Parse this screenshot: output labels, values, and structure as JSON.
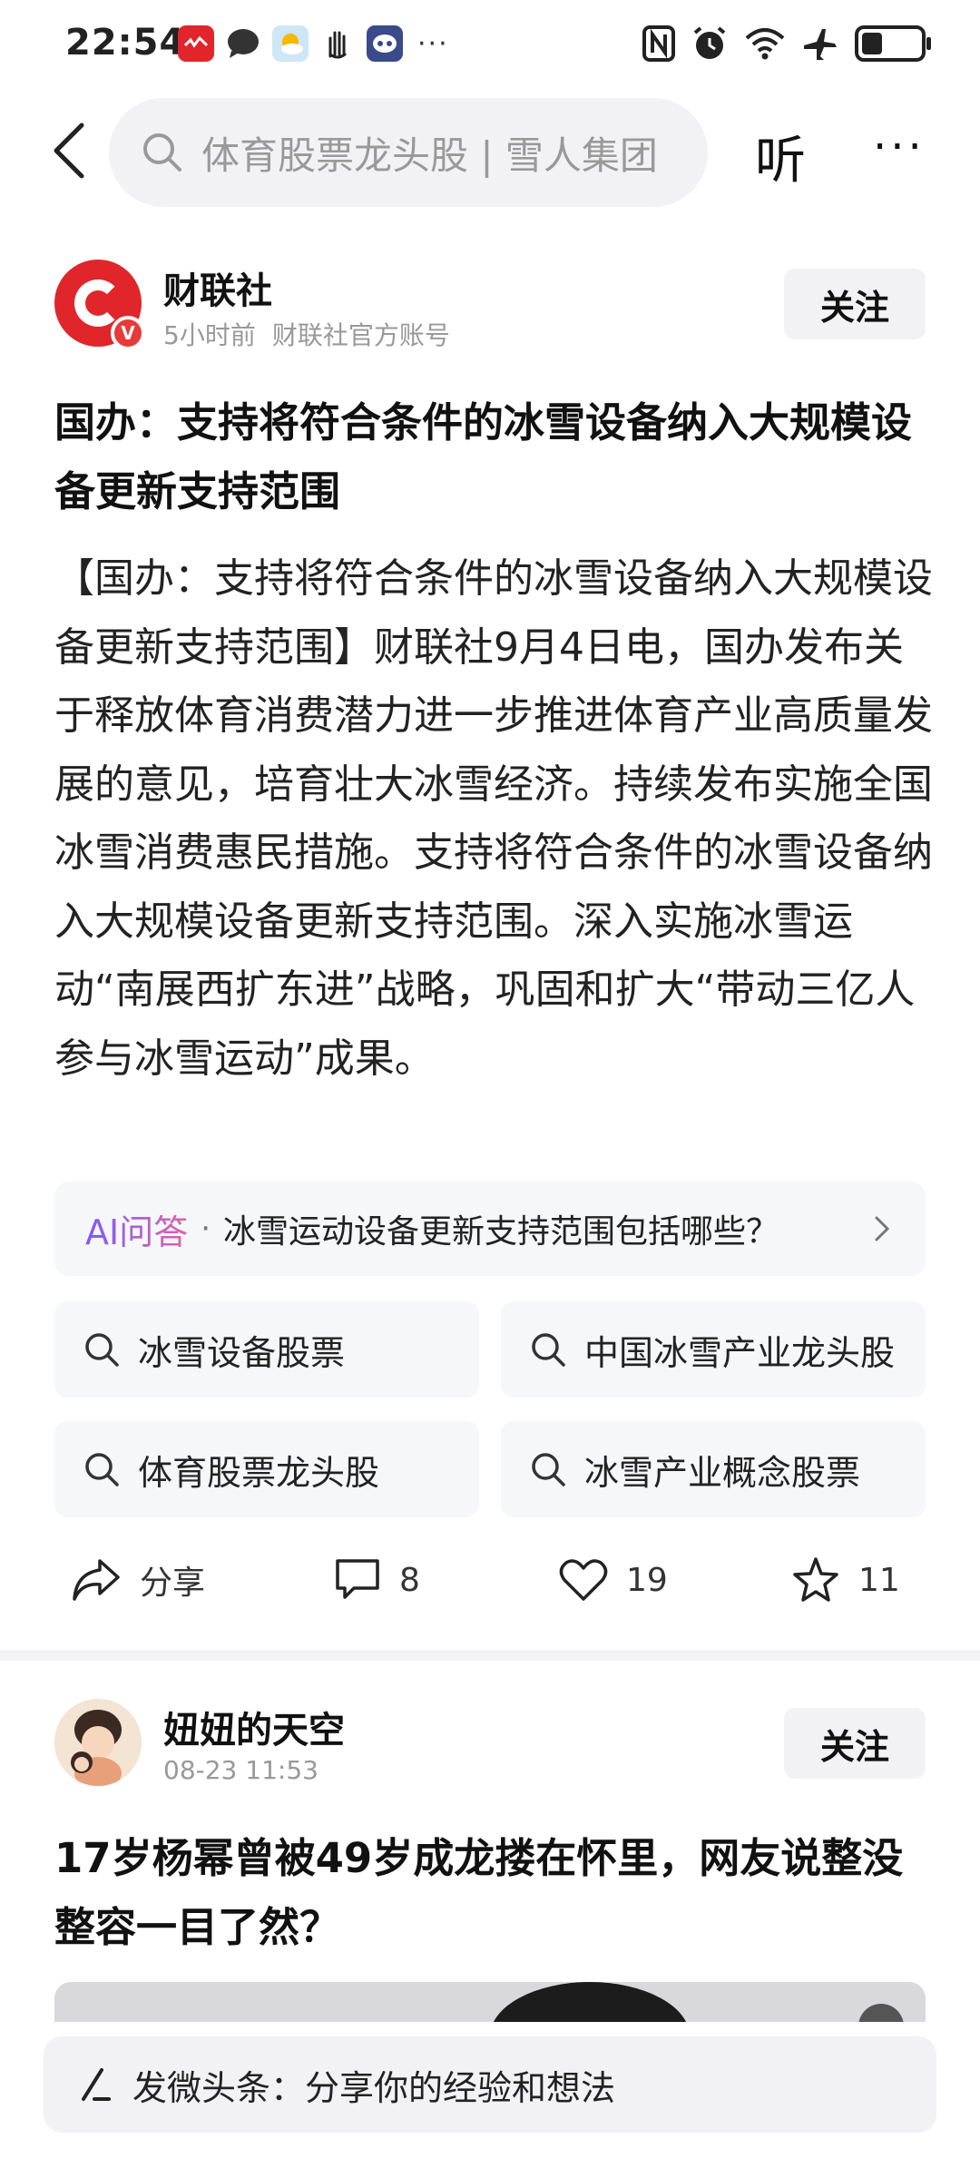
{
  "status_bar": {
    "time": "22:54",
    "notification_icons": [
      {
        "name": "red-app-icon",
        "color": "#e0262b"
      },
      {
        "name": "chat-bubble-icon",
        "color": "#333333"
      },
      {
        "name": "weather-icon",
        "color": "#f5b700"
      },
      {
        "name": "hand-icon",
        "color": "#222222"
      },
      {
        "name": "assistant-icon",
        "color": "#3a4a8a"
      }
    ],
    "more_dots": "···",
    "system_icons": [
      "nfc-icon",
      "alarm-icon",
      "wifi-icon",
      "airplane-icon",
      "battery-icon"
    ],
    "battery_level": 0.35
  },
  "top_nav": {
    "search_text": "体育股票龙头股 | 雪人集团",
    "listen_label": "听",
    "more_label": "···"
  },
  "article1": {
    "author": "财联社",
    "time": "5小时前",
    "account_type": "财联社官方账号",
    "follow_label": "关注",
    "headline": "国办：支持将符合条件的冰雪设备纳入大规模设备更新支持范围",
    "body": "【国办：支持将符合条件的冰雪设备纳入大规模设备更新支持范围】财联社9月4日电，国办发布关于释放体育消费潜力进一步推进体育产业高质量发展的意见，培育壮大冰雪经济。持续发布实施全国冰雪消费惠民措施。支持将符合条件的冰雪设备纳入大规模设备更新支持范围。深入实施冰雪运动“南展西扩东进”战略，巩固和扩大“带动三亿人参与冰雪运动”成果。",
    "ai_label": "AI问答",
    "ai_separator": "·",
    "ai_question": "冰雪运动设备更新支持范围包括哪些？",
    "search_tags": [
      "冰雪设备股票",
      "中国冰雪产业龙头股",
      "体育股票龙头股",
      "冰雪产业概念股票"
    ],
    "actions": {
      "share_label": "分享",
      "comments": "8",
      "likes": "19",
      "favorites": "11"
    }
  },
  "article2": {
    "author": "妞妞的天空",
    "time": "08-23 11:53",
    "follow_label": "关注",
    "headline": "17岁杨幂曾被49岁成龙搂在怀里，网友说整没整容一目了然？"
  },
  "compose_bar": {
    "text": "发微头条：分享你的经验和想法"
  },
  "colors": {
    "brand_red": "#e0262b",
    "ai_gradient_start": "#7a5cff",
    "ai_gradient_end": "#e064a4",
    "chip_bg": "#f6f7f9"
  }
}
